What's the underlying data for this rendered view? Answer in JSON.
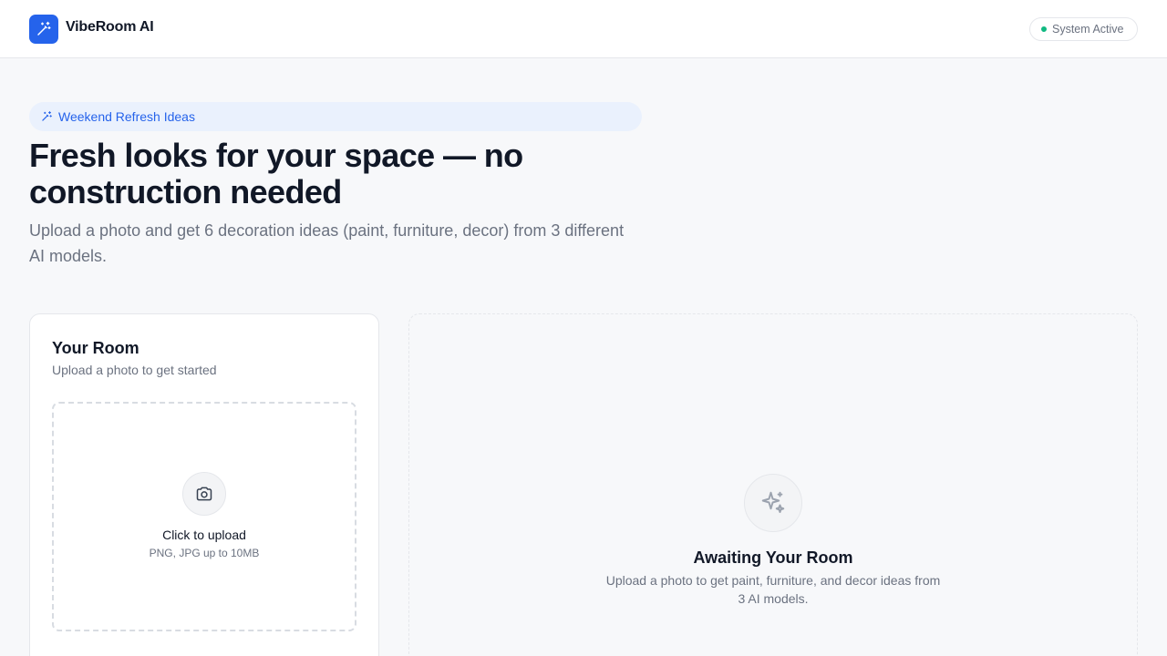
{
  "header": {
    "brand": "VibeRoom AI",
    "logo_icon": "magic-wand-icon",
    "status_label": "System Active",
    "status_color": "#10b981"
  },
  "hero": {
    "badge_icon": "sparkles-wand-icon",
    "badge_label": "Weekend Refresh Ideas",
    "title": "Fresh looks for your space — no construction needed",
    "subtitle": "Upload a photo and get 6 decoration ideas (paint, furniture, decor) from 3 different AI models."
  },
  "room_card": {
    "title": "Your Room",
    "subtitle": "Upload a photo to get started",
    "upload_icon": "camera-icon",
    "upload_label": "Click to upload",
    "upload_hint": "PNG, JPG up to 10MB"
  },
  "results_panel": {
    "icon": "sparkles-icon",
    "title": "Awaiting Your Room",
    "subtitle": "Upload a photo to get paint, furniture, and decor ideas from 3 AI models."
  },
  "colors": {
    "accent": "#2563eb",
    "background": "#f7f8fa",
    "text": "#111827",
    "muted": "#6b7280"
  }
}
